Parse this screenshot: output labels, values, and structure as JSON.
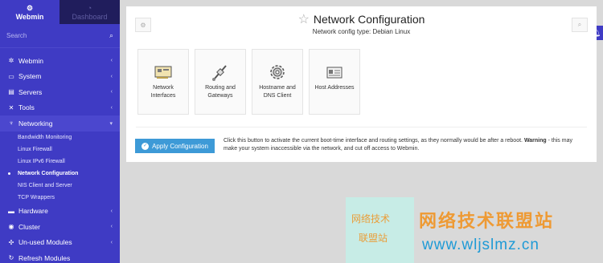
{
  "sidebar": {
    "tabs": [
      {
        "label": "Webmin",
        "icon": "webmin-icon"
      },
      {
        "label": "Dashboard",
        "icon": "dashboard-icon"
      }
    ],
    "search_placeholder": "Search",
    "menu": [
      {
        "label": "Webmin"
      },
      {
        "label": "System"
      },
      {
        "label": "Servers"
      },
      {
        "label": "Tools"
      },
      {
        "label": "Networking"
      }
    ],
    "submenu": [
      "Bandwidth Monitoring",
      "Linux Firewall",
      "Linux IPv6 Firewall",
      "Network Configuration",
      "NIS Client and Server",
      "TCP Wrappers"
    ],
    "menu_after": [
      {
        "label": "Hardware"
      },
      {
        "label": "Cluster"
      },
      {
        "label": "Un-used Modules"
      },
      {
        "label": "Refresh Modules"
      }
    ]
  },
  "header": {
    "title": "Network Configuration",
    "subtitle": "Network config type: Debian Linux"
  },
  "tiles": [
    {
      "label_line1": "Network",
      "label_line2": "Interfaces",
      "icon": "network-card-icon"
    },
    {
      "label_line1": "Routing and",
      "label_line2": "Gateways",
      "icon": "cable-icon"
    },
    {
      "label_line1": "Hostname and",
      "label_line2": "DNS Client",
      "icon": "gear-icon"
    },
    {
      "label_line1": "Host Addresses",
      "label_line2": "",
      "icon": "address-card-icon"
    }
  ],
  "apply": {
    "button_label": "Apply Configuration",
    "desc_part1": "Click this button to activate the current boot-time interface and routing settings, as they normally would be after a reboot.",
    "desc_warning": "Warning",
    "desc_part2": "- this may make your system inaccessible via the network, and cut off access to Webmin."
  },
  "watermark": {
    "small_line1": "网络技术",
    "small_line2": "联盟站",
    "title": "网络技术联盟站",
    "url": "www.wljslmz.cn"
  },
  "colors": {
    "sidebar_bg": "#3f3bc4",
    "apply_button": "#3d9ad7",
    "watermark_orange": "#ee9a34",
    "watermark_blue": "#1e9ad6"
  }
}
